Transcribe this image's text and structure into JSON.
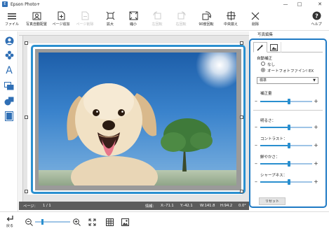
{
  "window": {
    "title": "Epson Photo+"
  },
  "toolbar": {
    "file": "ファイル",
    "auto_layout": "写真自動配置",
    "add_page": "ページ追加",
    "add_page2": "ページ削除",
    "zoom_in": "拡大",
    "zoom_out": "縮小",
    "rotate_left": "左回転",
    "rotate_right": "右回転",
    "rotate90": "90度回転",
    "center": "中央揃え",
    "delete": "削除",
    "help": "ヘルプ"
  },
  "panel": {
    "header": "写真編集",
    "auto_correct": "自動補正",
    "option_none": "なし",
    "option_auto": "オートフォトファイン! EX",
    "select_value": "標準",
    "correction_amount": "補正量",
    "brightness": "明るさ：",
    "contrast": "コントラスト：",
    "saturation": "鮮やかさ：",
    "sharpness": "シャープネス：",
    "reset": "リセット",
    "selected_option": "auto",
    "levels": {
      "correction": 0.55,
      "brightness": 0.55,
      "contrast": 0.55,
      "saturation": 0.55,
      "sharpness": 0.55
    }
  },
  "status": {
    "page_label": "ページ：",
    "page_value": "1 / 1",
    "info_label": "情報：",
    "x": "X:-71.1",
    "y": "Y:-42.1",
    "w": "W:141.8",
    "h": "H:94.2",
    "angle": "0.0°"
  },
  "bottom": {
    "back": "戻る",
    "zoom_level": 0.2
  },
  "colors": {
    "accent": "#2a8fcf",
    "panel_border": "#1f7ac4",
    "status_bg": "#5c5c5c"
  }
}
